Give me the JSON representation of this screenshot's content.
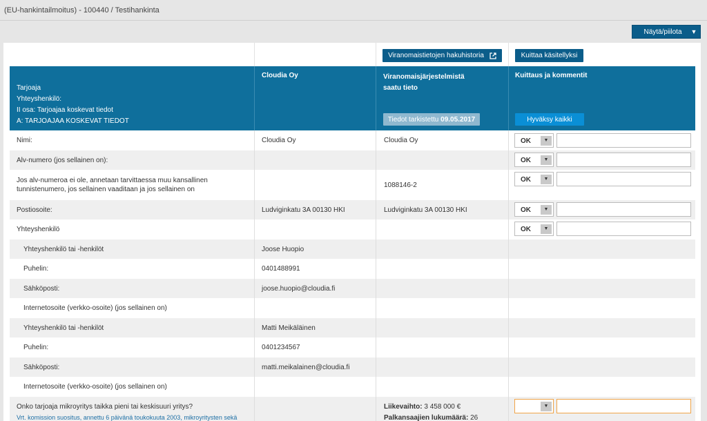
{
  "page_title": "(EU-hankintailmoitus) - 100440 / Testihankinta",
  "toggle_button": "Näytä/piilota",
  "buttons": {
    "history": "Viranomaistietojen hakuhistoria",
    "acknowledge": "Kuittaa käsitellyksi",
    "checked_prefix": "Tiedot tarkistettu",
    "checked_date": "09.05.2017",
    "approve_all": "Hyväksy kaikki"
  },
  "header": {
    "col1_lines": [
      "Tarjoaja",
      "Yhteyshenkilö:",
      "II osa: Tarjoajaa koskevat tiedot",
      "A: TARJOAJAA KOSKEVAT TIEDOT"
    ],
    "col2": "Cloudia Oy",
    "col3_line1": "Viranomaisjärjestelmistä",
    "col3_line2": "saatu tieto",
    "col4": "Kuittaus ja kommentit"
  },
  "rows": [
    {
      "label": "Nimi:",
      "value": "Cloudia Oy",
      "authority": "Cloudia Oy",
      "status": "OK"
    },
    {
      "label": "Alv-numero (jos sellainen on):",
      "value": "",
      "authority": "",
      "status": "OK"
    },
    {
      "label": "Jos alv-numeroa ei ole, annetaan tarvittaessa muu kansallinen tunnistenumero, jos sellainen vaaditaan ja jos sellainen on",
      "value": "",
      "authority": "1088146-2",
      "status": "OK"
    },
    {
      "label": "Postiosoite:",
      "value": "Ludviginkatu 3A 00130 HKI",
      "authority": "Ludviginkatu 3A 00130 HKI",
      "status": "OK"
    },
    {
      "label": "Yhteyshenkilö",
      "value": "",
      "authority": "",
      "status": "OK"
    },
    {
      "label": "Yhteyshenkilö tai -henkilöt",
      "value": "Joose Huopio",
      "authority": "",
      "status": ""
    },
    {
      "label": "Puhelin:",
      "value": "0401488991",
      "authority": "",
      "status": ""
    },
    {
      "label": "Sähköposti:",
      "value": "joose.huopio@cloudia.fi",
      "authority": "",
      "status": ""
    },
    {
      "label": "Internetosoite (verkko-osoite) (jos sellainen on)",
      "value": "",
      "authority": "",
      "status": ""
    },
    {
      "label": "Yhteyshenkilö tai -henkilöt",
      "value": "Matti Meikäläinen",
      "authority": "",
      "status": ""
    },
    {
      "label": "Puhelin:",
      "value": "0401234567",
      "authority": "",
      "status": ""
    },
    {
      "label": "Sähköposti:",
      "value": "matti.meikalainen@cloudia.fi",
      "authority": "",
      "status": ""
    },
    {
      "label": "Internetosoite (verkko-osoite) (jos sellainen on)",
      "value": "",
      "authority": "",
      "status": ""
    }
  ],
  "last_row": {
    "question": "Onko tarjoaja mikroyritys taikka pieni tai keskisuuri yritys?",
    "link": "Vrt. komission suositus, annettu 6 päivänä toukokuuta 2003, mikroyritysten sekä",
    "revenue_label": "Liikevaihto:",
    "revenue_value": "3 458 000 €",
    "employees_label": "Palkansaajien lukumäärä:",
    "employees_value": "26"
  }
}
